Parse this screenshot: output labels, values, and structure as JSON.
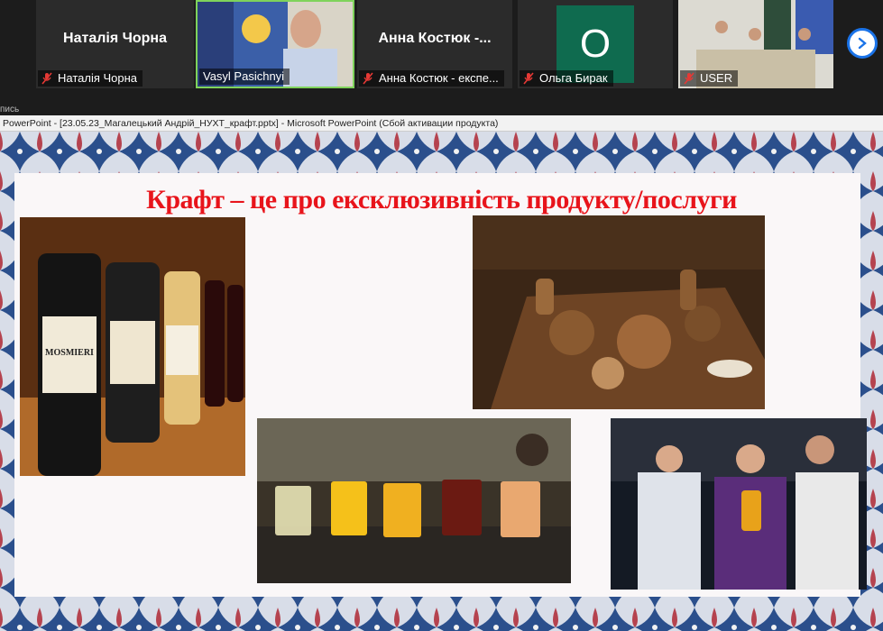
{
  "participants": [
    {
      "display_name": "Наталія Чорна",
      "caption": "Наталія Чорна",
      "muted": true
    },
    {
      "display_name": "",
      "caption": "Vasyl Pasichnyi",
      "muted": false
    },
    {
      "display_name": "Анна Костюк -...",
      "caption": "Анна Костюк - експе...",
      "muted": true
    },
    {
      "display_name": "",
      "avatar_letter": "О",
      "caption": "Ольга Бирак",
      "muted": true
    },
    {
      "display_name": "",
      "caption": "USER",
      "muted": true
    }
  ],
  "sublabel": "пись",
  "window_title": "PowerPoint - [23.05.23_Магалецький Андрій_НУХТ_крафт.pptx] - Microsoft PowerPoint (Сбой активации продукта)",
  "slide": {
    "title": "Крафт – це про ексклюзивність продукту/послуги",
    "wine_label": "MOSMIERI"
  },
  "colors": {
    "accent": "#1a73e8",
    "title_red": "#e8141b",
    "avatar_green": "#0f6b4f",
    "mic_red": "#e53935"
  }
}
